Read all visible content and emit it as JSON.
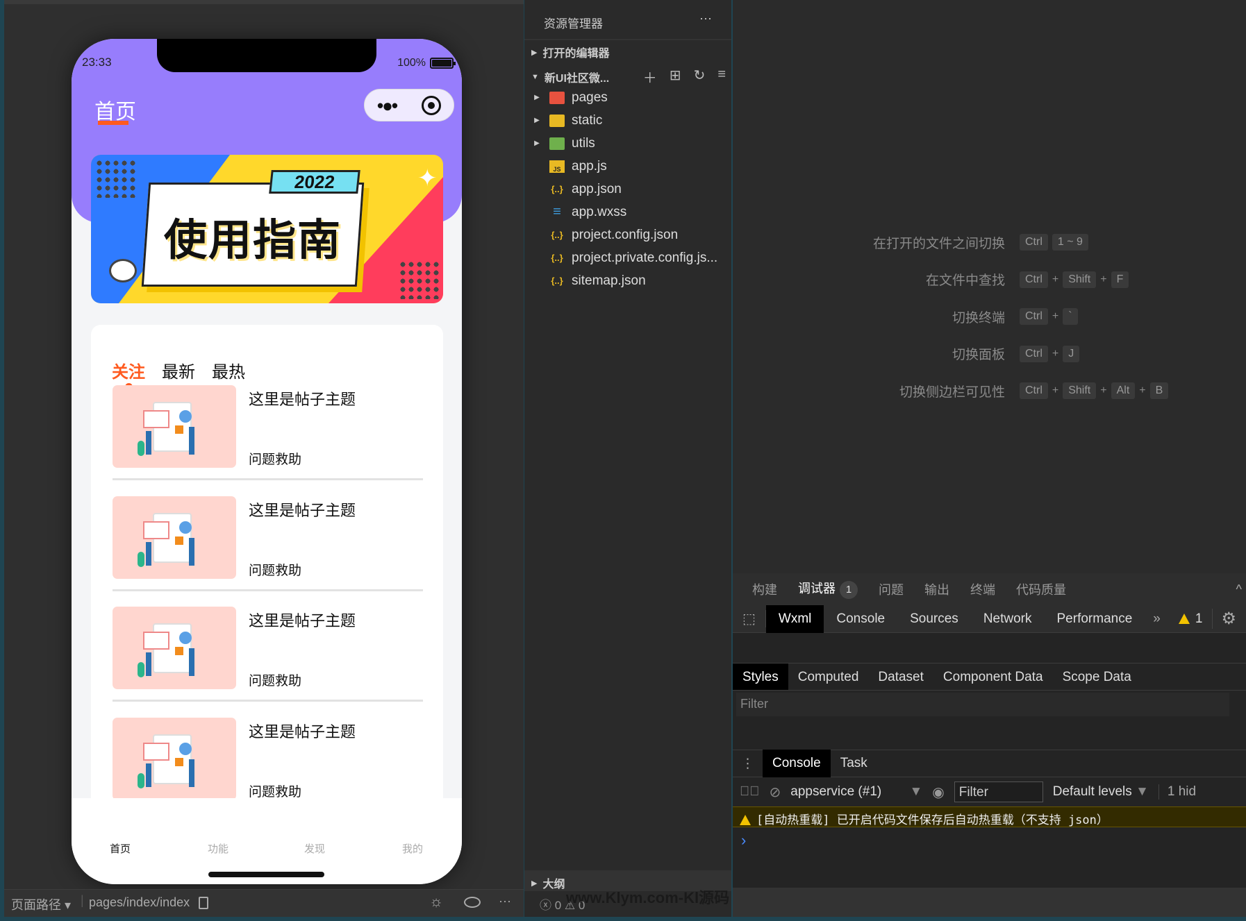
{
  "simulator": {
    "status_time": "23:33",
    "battery": "100%",
    "battery_level": 1.0,
    "nav_title": "首页",
    "capsule": {
      "more_icon": "more-dots-icon",
      "close_icon": "target-circle-icon"
    },
    "banner": {
      "year": "2022",
      "title": "使用指南"
    },
    "feed_tabs": [
      {
        "label": "关注",
        "active": true
      },
      {
        "label": "最新"
      },
      {
        "label": "最热"
      }
    ],
    "posts": [
      {
        "title": "这里是帖子主题",
        "tag": "问题救助"
      },
      {
        "title": "这里是帖子主题",
        "tag": "问题救助"
      },
      {
        "title": "这里是帖子主题",
        "tag": "问题救助"
      },
      {
        "title": "这里是帖子主题",
        "tag": "问题救助"
      }
    ],
    "tabbar": [
      {
        "label": "首页",
        "active": true
      },
      {
        "label": "功能"
      },
      {
        "label": "发现"
      },
      {
        "label": "我的"
      }
    ],
    "accent": "#ff5a1f",
    "header_color": "#977dfc"
  },
  "sim_bar": {
    "path_label": "页面路径",
    "path": "pages/index/index"
  },
  "explorer": {
    "title": "资源管理器",
    "more": "···",
    "open_editors": "打开的编辑器",
    "project": "新UI社区微...",
    "files": [
      {
        "name": "pages",
        "type": "folder",
        "color": "#e8523f"
      },
      {
        "name": "static",
        "type": "folder",
        "color": "#e8b923"
      },
      {
        "name": "utils",
        "type": "folder",
        "color": "#6fb04c"
      },
      {
        "name": "app.js",
        "type": "js"
      },
      {
        "name": "app.json",
        "type": "json"
      },
      {
        "name": "app.wxss",
        "type": "css"
      },
      {
        "name": "project.config.json",
        "type": "json"
      },
      {
        "name": "project.private.config.js...",
        "type": "json"
      },
      {
        "name": "sitemap.json",
        "type": "json"
      }
    ],
    "outline": "大纲",
    "errors": "0",
    "warnings": "0",
    "watermark": "www.Klym.com-Kl源码"
  },
  "shortcuts": [
    {
      "label": "在打开的文件之间切换",
      "keys": [
        "Ctrl",
        "1 ~ 9"
      ],
      "joined": false
    },
    {
      "label": "在文件中查找",
      "keys": [
        "Ctrl",
        "Shift",
        "F"
      ],
      "joined": true
    },
    {
      "label": "切换终端",
      "keys": [
        "Ctrl",
        "`"
      ],
      "joined": true
    },
    {
      "label": "切换面板",
      "keys": [
        "Ctrl",
        "J"
      ],
      "joined": true
    },
    {
      "label": "切换侧边栏可见性",
      "keys": [
        "Ctrl",
        "Shift",
        "Alt",
        "B"
      ],
      "joined": true
    }
  ],
  "devtools": {
    "panel_tabs": [
      "构建",
      "调试器",
      "问题",
      "输出",
      "终端",
      "代码质量"
    ],
    "debugger_badge": "1",
    "tools": [
      "Wxml",
      "Console",
      "Sources",
      "Network",
      "Performance"
    ],
    "more": "»",
    "warning_count": "1",
    "style_tabs": [
      "Styles",
      "Computed",
      "Dataset",
      "Component Data",
      "Scope Data"
    ],
    "styles_filter_placeholder": "Filter",
    "drawer_tabs": [
      "Console",
      "Task"
    ],
    "context": "appservice (#1)",
    "console_filter_placeholder": "Filter",
    "levels": "Default levels",
    "hidden": "1 hid",
    "message": "[自动热重载] 已开启代码文件保存后自动热重载（不支持 json）",
    "prompt": "›"
  }
}
